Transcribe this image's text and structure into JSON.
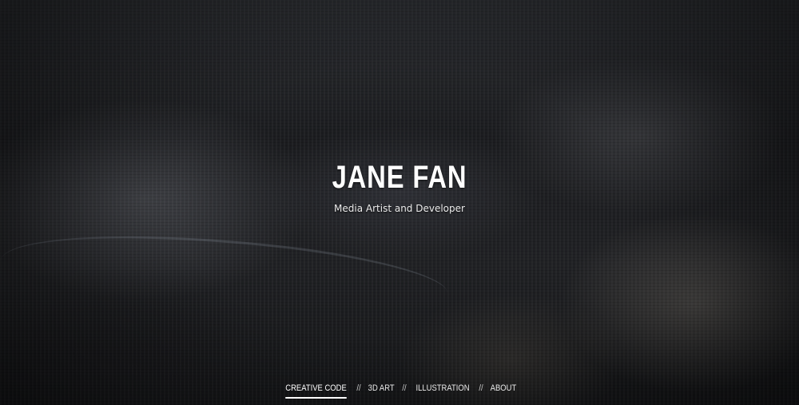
{
  "hero": {
    "title": "JANE FAN",
    "subtitle": "Media Artist and Developer"
  },
  "nav": {
    "items": [
      {
        "label": "CREATIVE CODE",
        "active": true
      },
      {
        "label": "3D ART",
        "active": false
      },
      {
        "label": "ILLUSTRATION",
        "active": false
      },
      {
        "label": "ABOUT",
        "active": false
      }
    ],
    "separator": "//"
  },
  "colors": {
    "text": "#ffffff",
    "background": "#1b1c1f"
  }
}
